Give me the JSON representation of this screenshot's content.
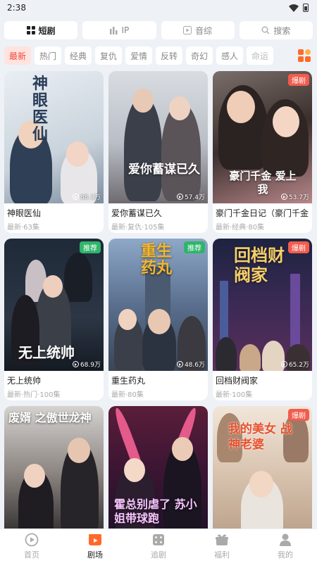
{
  "status": {
    "time": "2:38"
  },
  "top_tabs": [
    {
      "label": "短剧",
      "icon": "grid-icon",
      "active": true
    },
    {
      "label": "IP",
      "icon": "bar-chart-icon",
      "active": false
    },
    {
      "label": "音综",
      "icon": "play-square-icon",
      "active": false
    },
    {
      "label": "搜索",
      "icon": "search-icon",
      "active": false
    }
  ],
  "categories": [
    "最新",
    "热门",
    "经典",
    "复仇",
    "爱情",
    "反转",
    "奇幻",
    "感人",
    "命运"
  ],
  "active_category": "最新",
  "cards": [
    {
      "title": "神眼医仙",
      "meta": "最新·63集",
      "views": "88.3万",
      "badge": "",
      "poster_text": "神眼医仙"
    },
    {
      "title": "爱你蓄谋已久",
      "meta": "最新·复仇·105集",
      "views": "57.4万",
      "badge": "",
      "poster_text": "爱你蓄谋已久"
    },
    {
      "title": "豪门千金日记（豪门千金",
      "meta": "最新·经典·80集",
      "views": "53.7万",
      "badge": "爆剧",
      "poster_text": "豪门千金 爱上我"
    },
    {
      "title": "无上统帅",
      "meta": "最新·热门·100集",
      "views": "68.9万",
      "badge": "推荐",
      "poster_text": "无上统帅"
    },
    {
      "title": "重生药丸",
      "meta": "最新·80集",
      "views": "48.6万",
      "badge": "推荐",
      "poster_text": "重生药丸"
    },
    {
      "title": "回档财阀家",
      "meta": "最新·100集",
      "views": "65.2万",
      "badge": "爆剧",
      "poster_text": "回档财阀家"
    },
    {
      "title": "",
      "meta": "",
      "views": "",
      "badge": "",
      "poster_text": "废婿 之傲世龙神"
    },
    {
      "title": "",
      "meta": "",
      "views": "",
      "badge": "",
      "poster_text": "霍总别虐了 苏小姐带球跑"
    },
    {
      "title": "",
      "meta": "",
      "views": "",
      "badge": "爆剧",
      "poster_text": "我的美女 战神老婆"
    }
  ],
  "bottom_nav": [
    {
      "label": "首页",
      "icon": "home-play-icon",
      "active": false
    },
    {
      "label": "剧场",
      "icon": "theater-icon",
      "active": true
    },
    {
      "label": "追剧",
      "icon": "dice-icon",
      "active": false
    },
    {
      "label": "福利",
      "icon": "gift-icon",
      "active": false
    },
    {
      "label": "我的",
      "icon": "user-icon",
      "active": false
    }
  ],
  "colors": {
    "accent": "#f04a3c",
    "hot_badge": "#f15c4e",
    "rec_badge": "#2fb56a",
    "background": "#eef1f6"
  }
}
